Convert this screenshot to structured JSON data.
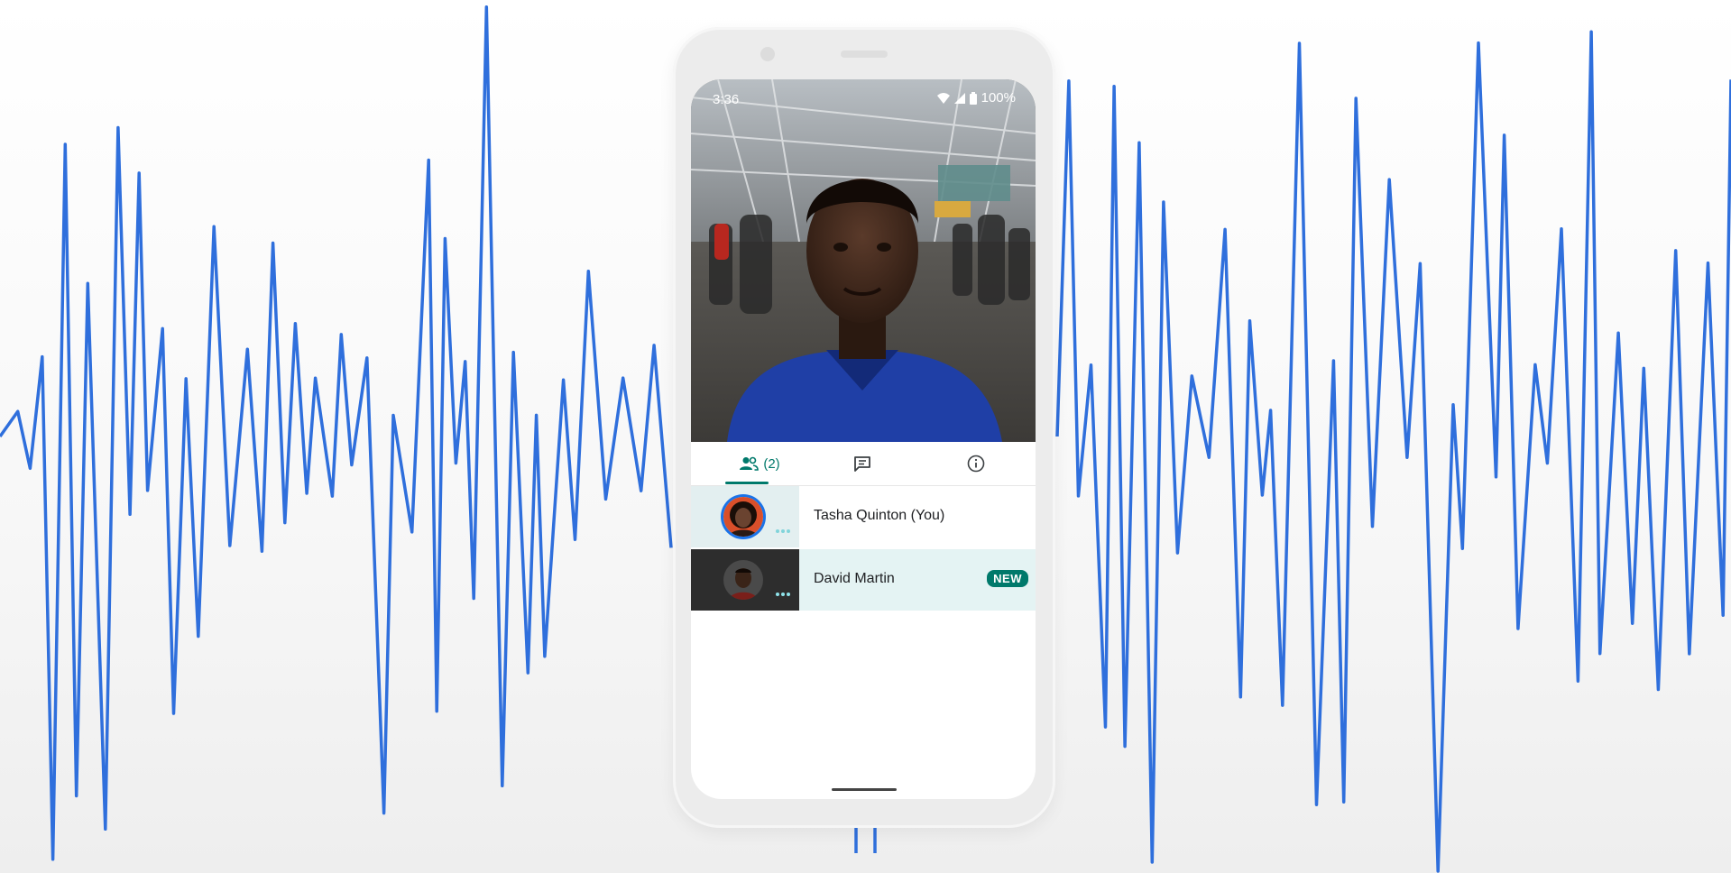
{
  "status_bar": {
    "time": "3:36",
    "battery": "100%"
  },
  "tabs": [
    {
      "name": "people",
      "icon": "people-icon",
      "count": "(2)",
      "selected": true
    },
    {
      "name": "chat",
      "icon": "chat-icon",
      "selected": false
    },
    {
      "name": "info",
      "icon": "info-icon",
      "selected": false
    }
  ],
  "participants": [
    {
      "name": "Tasha Quinton (You)",
      "badge": ""
    },
    {
      "name": "David Martin",
      "badge": "NEW"
    }
  ],
  "colors": {
    "waveform": "#2f6fdc",
    "accent": "#00796b",
    "highlight_row": "#e4f3f3",
    "avatar_ring": "#1a73e8"
  }
}
